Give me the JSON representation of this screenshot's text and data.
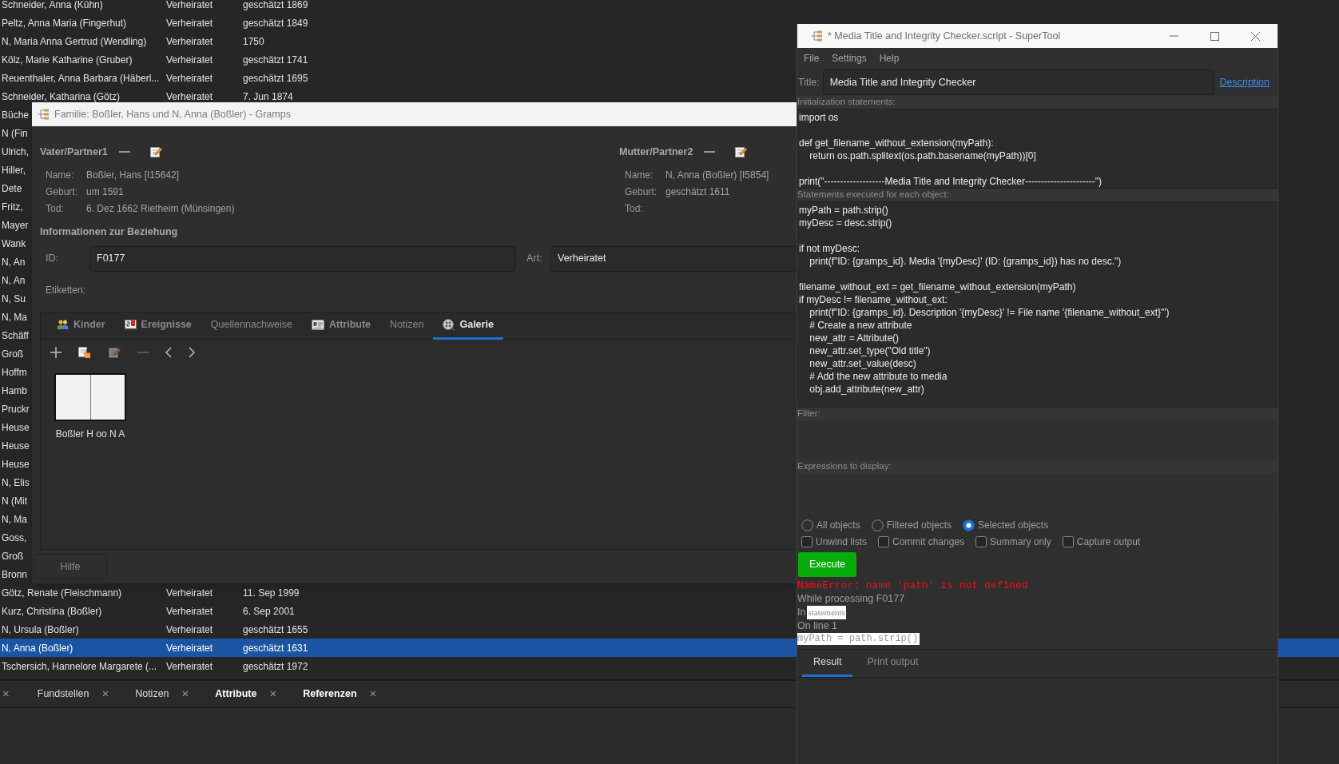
{
  "background_list": {
    "rows": [
      {
        "name": "Schneider, Anna (Kühn)",
        "status": "Verheiratet",
        "date": "geschätzt 1869",
        "selected": false
      },
      {
        "name": "Peltz, Anna Maria (Fingerhut)",
        "status": "Verheiratet",
        "date": "geschätzt 1849",
        "selected": false
      },
      {
        "name": "N, Maria Anna Gertrud (Wendling)",
        "status": "Verheiratet",
        "date": "1750",
        "selected": false
      },
      {
        "name": "Kölz, Marie Katharine (Gruber)",
        "status": "Verheiratet",
        "date": "geschätzt 1741",
        "selected": false
      },
      {
        "name": "Reuenthaler, Anna Barbara (Häberl...",
        "status": "Verheiratet",
        "date": "geschätzt 1695",
        "selected": false
      },
      {
        "name": "Schneider, Katharina (Götz)",
        "status": "Verheiratet",
        "date": "7. Jun 1874",
        "selected": false
      },
      {
        "name": "Büche",
        "selected": false
      },
      {
        "name": "N (Fin",
        "selected": false
      },
      {
        "name": "Ulrich,",
        "selected": false
      },
      {
        "name": "Hiller,",
        "selected": false
      },
      {
        "name": "Dete",
        "selected": false
      },
      {
        "name": "Fritz,",
        "selected": false
      },
      {
        "name": "Mayer",
        "selected": false
      },
      {
        "name": "Wank",
        "selected": false
      },
      {
        "name": "N, An",
        "selected": false
      },
      {
        "name": "N, An",
        "selected": false
      },
      {
        "name": "N, Su",
        "selected": false
      },
      {
        "name": "N, Ma",
        "selected": false
      },
      {
        "name": "Schäff",
        "selected": false
      },
      {
        "name": "Groß",
        "selected": false
      },
      {
        "name": "Hoffm",
        "selected": false
      },
      {
        "name": "Hamb",
        "selected": false
      },
      {
        "name": "Pruckr",
        "selected": false
      },
      {
        "name": "Heuse",
        "selected": false
      },
      {
        "name": "Heuse",
        "selected": false
      },
      {
        "name": "Heuse",
        "selected": false
      },
      {
        "name": "N, Elis",
        "selected": false
      },
      {
        "name": "N (Mit",
        "selected": false
      },
      {
        "name": "N, Ma",
        "selected": false
      },
      {
        "name": "Goss,",
        "selected": false
      },
      {
        "name": "Groß",
        "selected": false
      },
      {
        "name": "Bronn",
        "selected": false
      },
      {
        "name": "Götz, Renate (Fleischmann)",
        "status": "Verheiratet",
        "date": "11. Sep 1999",
        "selected": false
      },
      {
        "name": "Kurz, Christina (Boßler)",
        "status": "Verheiratet",
        "date": "6. Sep 2001",
        "selected": false
      },
      {
        "name": "N, Ursula (Boßler)",
        "status": "Verheiratet",
        "date": "geschätzt 1655",
        "selected": false
      },
      {
        "name": "N, Anna (Boßler)",
        "status": "Verheiratet",
        "date": "geschätzt 1631",
        "selected": true
      },
      {
        "name": "Tschersich, Hannelore Margarete (...",
        "status": "Verheiratet",
        "date": "geschätzt 1972",
        "selected": false
      }
    ]
  },
  "bottom_tabs": {
    "cut_tab_close": "×",
    "tabs": [
      {
        "label": "Fundstellen",
        "close": "×",
        "bold": false
      },
      {
        "label": "Notizen",
        "close": "×",
        "bold": false
      },
      {
        "label": "Attribute",
        "close": "×",
        "bold": true
      },
      {
        "label": "Referenzen",
        "close": "×",
        "bold": true
      }
    ]
  },
  "family_editor": {
    "title": "Familie: Boßler, Hans und N, Anna (Boßler) - Gramps",
    "partners": [
      {
        "heading": "Vater/Partner1",
        "fields": [
          {
            "label": "Name:",
            "value": "Boßler, Hans [I15642]"
          },
          {
            "label": "Geburt:",
            "value": "um 1591"
          },
          {
            "label": "Tod:",
            "value": "6. Dez 1662 Rietheim (Münsingen)"
          }
        ]
      },
      {
        "heading": "Mutter/Partner2",
        "fields": [
          {
            "label": "Name:",
            "value": "N, Anna (Boßler) [I5854]"
          },
          {
            "label": "Geburt:",
            "value": "geschätzt 1611"
          },
          {
            "label": "Tod:"
          }
        ]
      }
    ],
    "relationship": {
      "heading": "Informationen zur Beziehung",
      "id_label": "ID:",
      "id_value": "F0177",
      "type_label": "Art:",
      "type_value": "Verheiratet",
      "tags_label": "Etiketten:"
    },
    "tabs": [
      {
        "label": "Kinder",
        "bold": true,
        "selected": false
      },
      {
        "label": "Ereignisse",
        "bold": true,
        "selected": false
      },
      {
        "label": "Quellennachweise",
        "bold": false,
        "selected": false
      },
      {
        "label": "Attribute",
        "bold": true,
        "selected": false
      },
      {
        "label": "Notizen",
        "bold": false,
        "selected": false
      },
      {
        "label": "Galerie",
        "bold": true,
        "selected": true
      }
    ],
    "toolbar": [
      {
        "kind": "add",
        "disabled": false
      },
      {
        "kind": "share",
        "disabled": false
      },
      {
        "kind": "edit",
        "disabled": true
      },
      {
        "kind": "remove",
        "disabled": true
      },
      {
        "kind": "prev",
        "disabled": false
      },
      {
        "kind": "next",
        "disabled": false
      }
    ],
    "gallery": [
      {
        "caption": "Boßler H oo N A"
      }
    ],
    "help_button": "Hilfe"
  },
  "supertool": {
    "title": "* Media Title and Integrity Checker.script - SuperTool",
    "menu": [
      "File",
      "Settings",
      "Help"
    ],
    "title_label": "Title:",
    "title_value": "Media Title and Integrity Checker",
    "description_link": "Description",
    "sections": [
      {
        "label": "Initialization statements:",
        "code": "import os\n\ndef get_filename_without_extension(myPath):\n    return os.path.splitext(os.path.basename(myPath))[0]\n\nprint(\"-------------------Media Title and Integrity Checker----------------------\")"
      },
      {
        "label": "Statements executed for each object:",
        "code": "myPath = path.strip()\nmyDesc = desc.strip()\n\nif not myDesc:\n    print(f\"ID: {gramps_id}. Media '{myDesc}' (ID: {gramps_id}) has no desc.\")\n\nfilename_without_ext = get_filename_without_extension(myPath)\nif myDesc != filename_without_ext:\n    print(f\"ID: {gramps_id}. Description '{myDesc}' != File name '{filename_without_ext}'\")\n    # Create a new attribute\n    new_attr = Attribute()\n    new_attr.set_type(\"Old title\")\n    new_attr.set_value(desc)\n    # Add the new attribute to media\n    obj.add_attribute(new_attr)"
      },
      {
        "label": "Filter:"
      },
      {
        "label": "Expressions to display:"
      }
    ],
    "scope": [
      {
        "label": "All objects",
        "selected": false
      },
      {
        "label": "Filtered objects",
        "selected": false
      },
      {
        "label": "Selected objects",
        "selected": true
      }
    ],
    "options": [
      {
        "label": "Unwind lists",
        "checked": false
      },
      {
        "label": "Commit changes",
        "checked": false
      },
      {
        "label": "Summary only",
        "checked": false
      },
      {
        "label": "Capture output",
        "checked": false
      }
    ],
    "execute_button": "Execute",
    "output": [
      {
        "kind": "error",
        "text": "NameError: name 'path' is not defined"
      },
      {
        "kind": "plain",
        "text": "While processing F0177"
      },
      {
        "kind": "labeled",
        "prefix": "In",
        "highlight": "statements"
      },
      {
        "kind": "plain",
        "text": "On line 1"
      },
      {
        "kind": "code",
        "text": "myPath = path.strip()"
      }
    ],
    "result_tabs": [
      {
        "label": "Result",
        "selected": true
      },
      {
        "label": "Print output",
        "selected": false
      }
    ]
  }
}
